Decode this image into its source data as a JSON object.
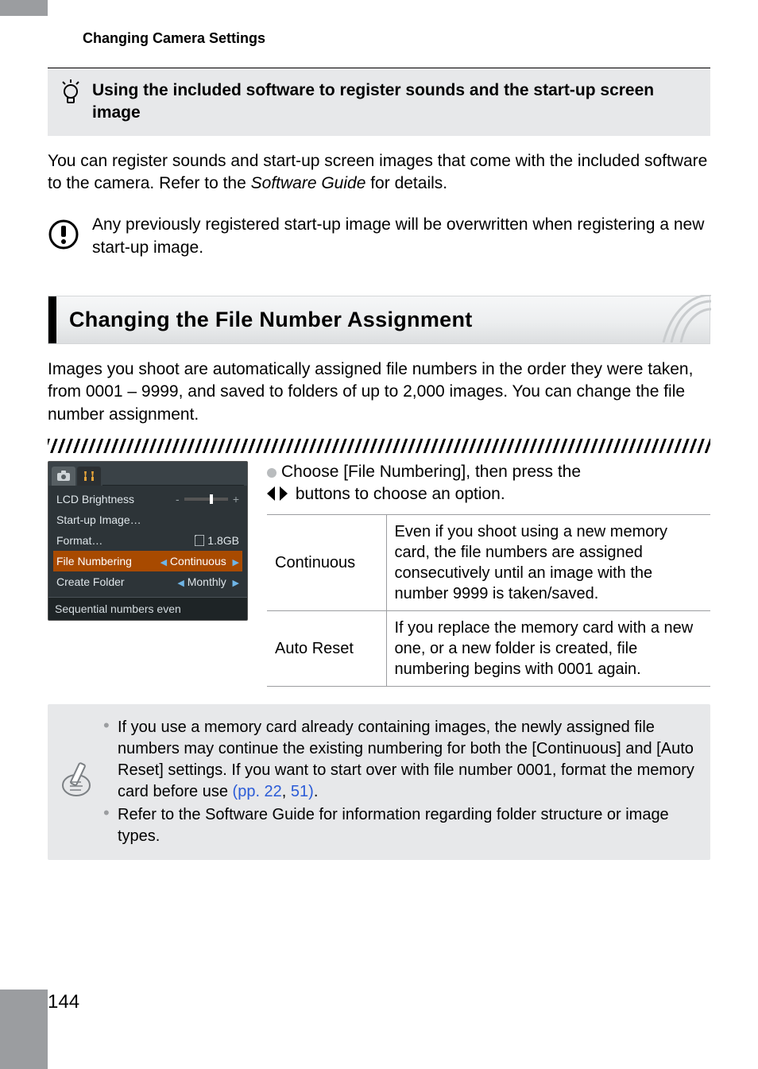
{
  "header_label": "Changing Camera Settings",
  "tip": {
    "title": "Using the included software to register sounds and the start-up screen image"
  },
  "intro_paragraph_a": "You can register sounds and start-up screen images that come with the included software to the camera. Refer to the ",
  "intro_paragraph_ref": "Software Guide",
  "intro_paragraph_b": " for details.",
  "overwrite_note": "Any previously registered start-up image will be overwritten when registering a new start-up image.",
  "section_title": "Changing the File Number Assignment",
  "section_intro": "Images you shoot are automatically assigned file numbers in the order they were taken, from 0001 – 9999, and saved to folders of up to 2,000 images. You can change the file number assignment.",
  "screenshot": {
    "rows": {
      "lcd": "LCD Brightness",
      "startup": "Start-up Image…",
      "format_label": "Format…",
      "format_value": "1.8GB",
      "filenum_label": "File Numbering",
      "filenum_value": "Continuous",
      "folder_label": "Create Folder",
      "folder_value": "Monthly"
    },
    "help": "Sequential numbers even"
  },
  "instruction_a": "Choose [File Numbering], then press the ",
  "instruction_b": " buttons to choose an option.",
  "options": {
    "continuous_label": "Continuous",
    "continuous_desc": "Even if you shoot using a new memory card, the file numbers are assigned consecutively until an image with the number 9999 is taken/saved.",
    "autoreset_label": "Auto Reset",
    "autoreset_desc": "If you replace the memory card with a new one, or a new folder is created, file numbering begins with 0001 again."
  },
  "callout": {
    "li1_a": "If you use a memory card already containing images, the newly assigned file numbers may continue the existing numbering for both the [Continuous] and [Auto Reset] settings. If you want to start over with file number 0001, format the memory card before use ",
    "li1_link1": "(pp. 22",
    "li1_mid": ", ",
    "li1_link2": "51)",
    "li1_b": ".",
    "li2_a": "Refer to the ",
    "li2_ref": "Software Guide",
    "li2_b": " for information regarding folder structure or image types."
  },
  "page_number": "144"
}
